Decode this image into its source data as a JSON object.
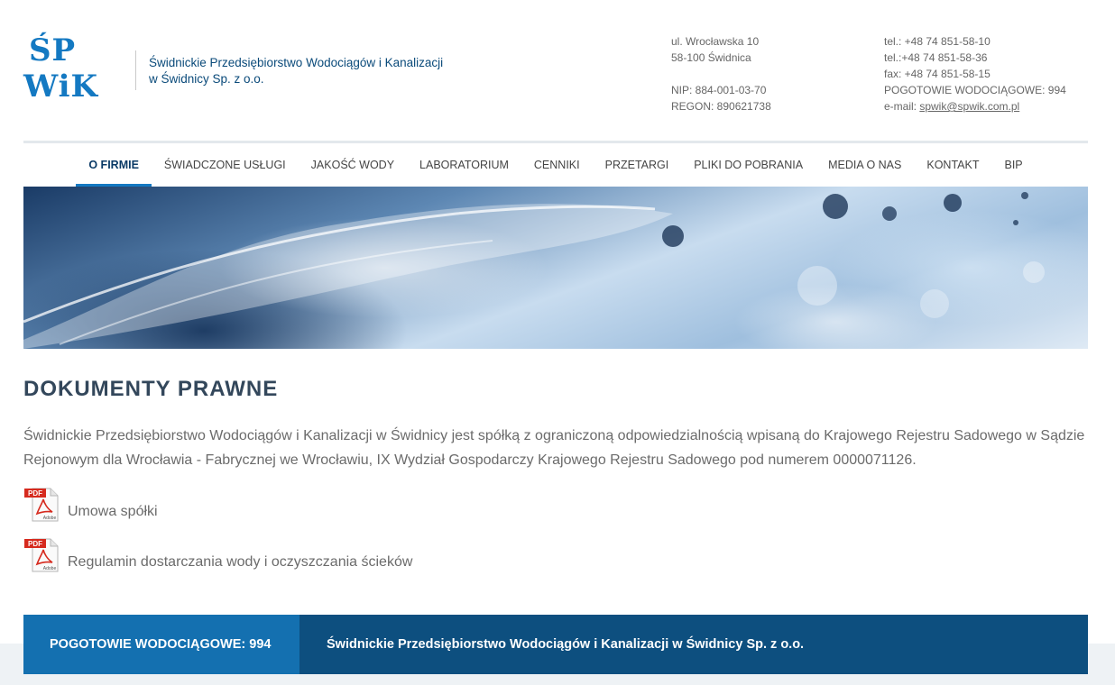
{
  "header": {
    "logo_line1": "ŚP",
    "logo_line2": "WiK",
    "company_line1": "Świdnickie Przedsiębiorstwo Wodociągów i Kanalizacji",
    "company_line2": "w Świdnicy Sp. z o.o.",
    "address": [
      "ul. Wrocławska 10",
      "58-100 Świdnica"
    ],
    "registry": [
      "NIP: 884-001-03-70",
      "REGON: 890621738"
    ],
    "phone1": "tel.: +48 74 851-58-10",
    "phone2": "tel.:+48 74 851-58-36",
    "fax": "fax: +48 74 851-58-15",
    "emergency": "POGOTOWIE WODOCIĄGOWE: 994",
    "email_label": "e-mail: ",
    "email": "spwik@spwik.com.pl"
  },
  "nav": {
    "items": [
      "O FIRMIE",
      "ŚWIADCZONE USŁUGI",
      "JAKOŚĆ WODY",
      "LABORATORIUM",
      "CENNIKI",
      "PRZETARGI",
      "PLIKI DO POBRANIA",
      "MEDIA O NAS",
      "KONTAKT",
      "BIP"
    ],
    "active": "O FIRMIE"
  },
  "main": {
    "title": "DOKUMENTY PRAWNE",
    "intro": "Świdnickie Przedsiębiorstwo Wodociągów i Kanalizacji w Świdnicy jest spółką z ograniczoną odpowiedzialnością wpisaną do Krajowego Rejestru Sadowego w Sądzie Rejonowym dla Wrocławia - Fabrycznej we Wrocławiu, IX Wydział Gospodarczy Krajowego Rejestru Sadowego pod numerem 0000071126.",
    "documents": [
      {
        "label": "Umowa spółki",
        "icon": "pdf-icon"
      },
      {
        "label": "Regulamin dostarczania wody i oczyszczania ścieków",
        "icon": "pdf-icon"
      }
    ],
    "pdf_icon_text": "PDF",
    "pdf_icon_brand": "Adobe"
  },
  "footer": {
    "emergency": "POGOTOWIE WODOCIĄGOWE: 994",
    "company": "Świdnickie Przedsiębiorstwo Wodociągów i Kanalizacji w Świdnicy Sp. z o.o."
  },
  "colors": {
    "brand": "#1479c2",
    "footer_left": "#1470b0",
    "footer_right": "#0d4f7f",
    "title": "#33475b"
  }
}
